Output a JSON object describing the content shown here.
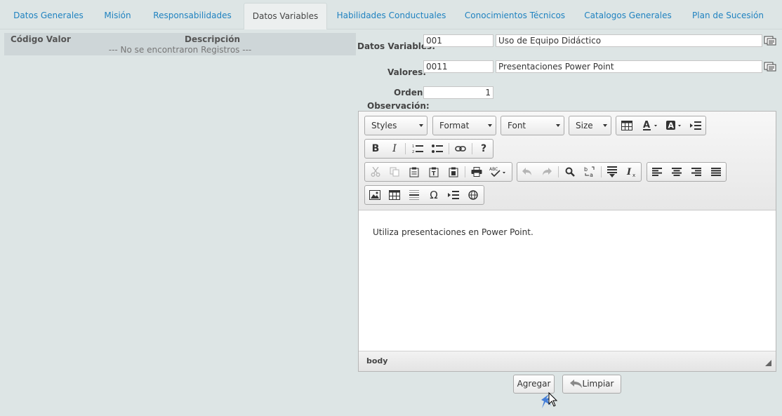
{
  "tabs": [
    {
      "label": "Datos Generales",
      "active": false
    },
    {
      "label": "Misión",
      "active": false
    },
    {
      "label": "Responsabilidades",
      "active": false
    },
    {
      "label": "Datos Variables",
      "active": true
    },
    {
      "label": "Habilidades Conductuales",
      "active": false
    },
    {
      "label": "Conocimientos Técnicos",
      "active": false
    },
    {
      "label": "Catalogos Generales",
      "active": false
    },
    {
      "label": "Plan de Sucesión",
      "active": false
    }
  ],
  "grid": {
    "col_code": "Código Valor",
    "col_desc": "Descripción",
    "empty_message": "--- No se encontraron Registros ---"
  },
  "form": {
    "datos_variables_label": "Datos Variables:",
    "datos_variables_code": "001",
    "datos_variables_desc": "Uso de Equipo Didáctico",
    "valores_label": "Valores:",
    "valores_code": "0011",
    "valores_desc": "Presentaciones Power Point",
    "orden_label": "Orden:",
    "orden_value": "1",
    "observacion_label": "Observación:"
  },
  "editor": {
    "styles": "Styles",
    "format": "Format",
    "font": "Font",
    "size": "Size",
    "content": "Utiliza presentaciones en Power Point.",
    "path": "body"
  },
  "actions": {
    "add": "Agregar",
    "clear": "Limpiar"
  }
}
